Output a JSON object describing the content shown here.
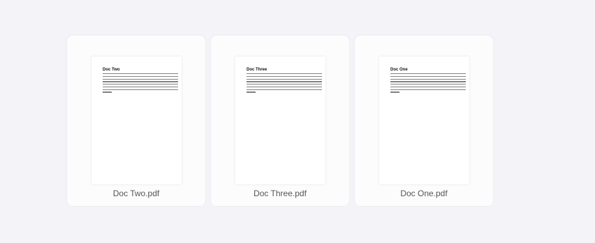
{
  "files": [
    {
      "name": "Doc Two.pdf",
      "thumbnail_title": "Doc Two"
    },
    {
      "name": "Doc Three.pdf",
      "thumbnail_title": "Doc Three"
    },
    {
      "name": "Doc One.pdf",
      "thumbnail_title": "Doc One"
    }
  ]
}
